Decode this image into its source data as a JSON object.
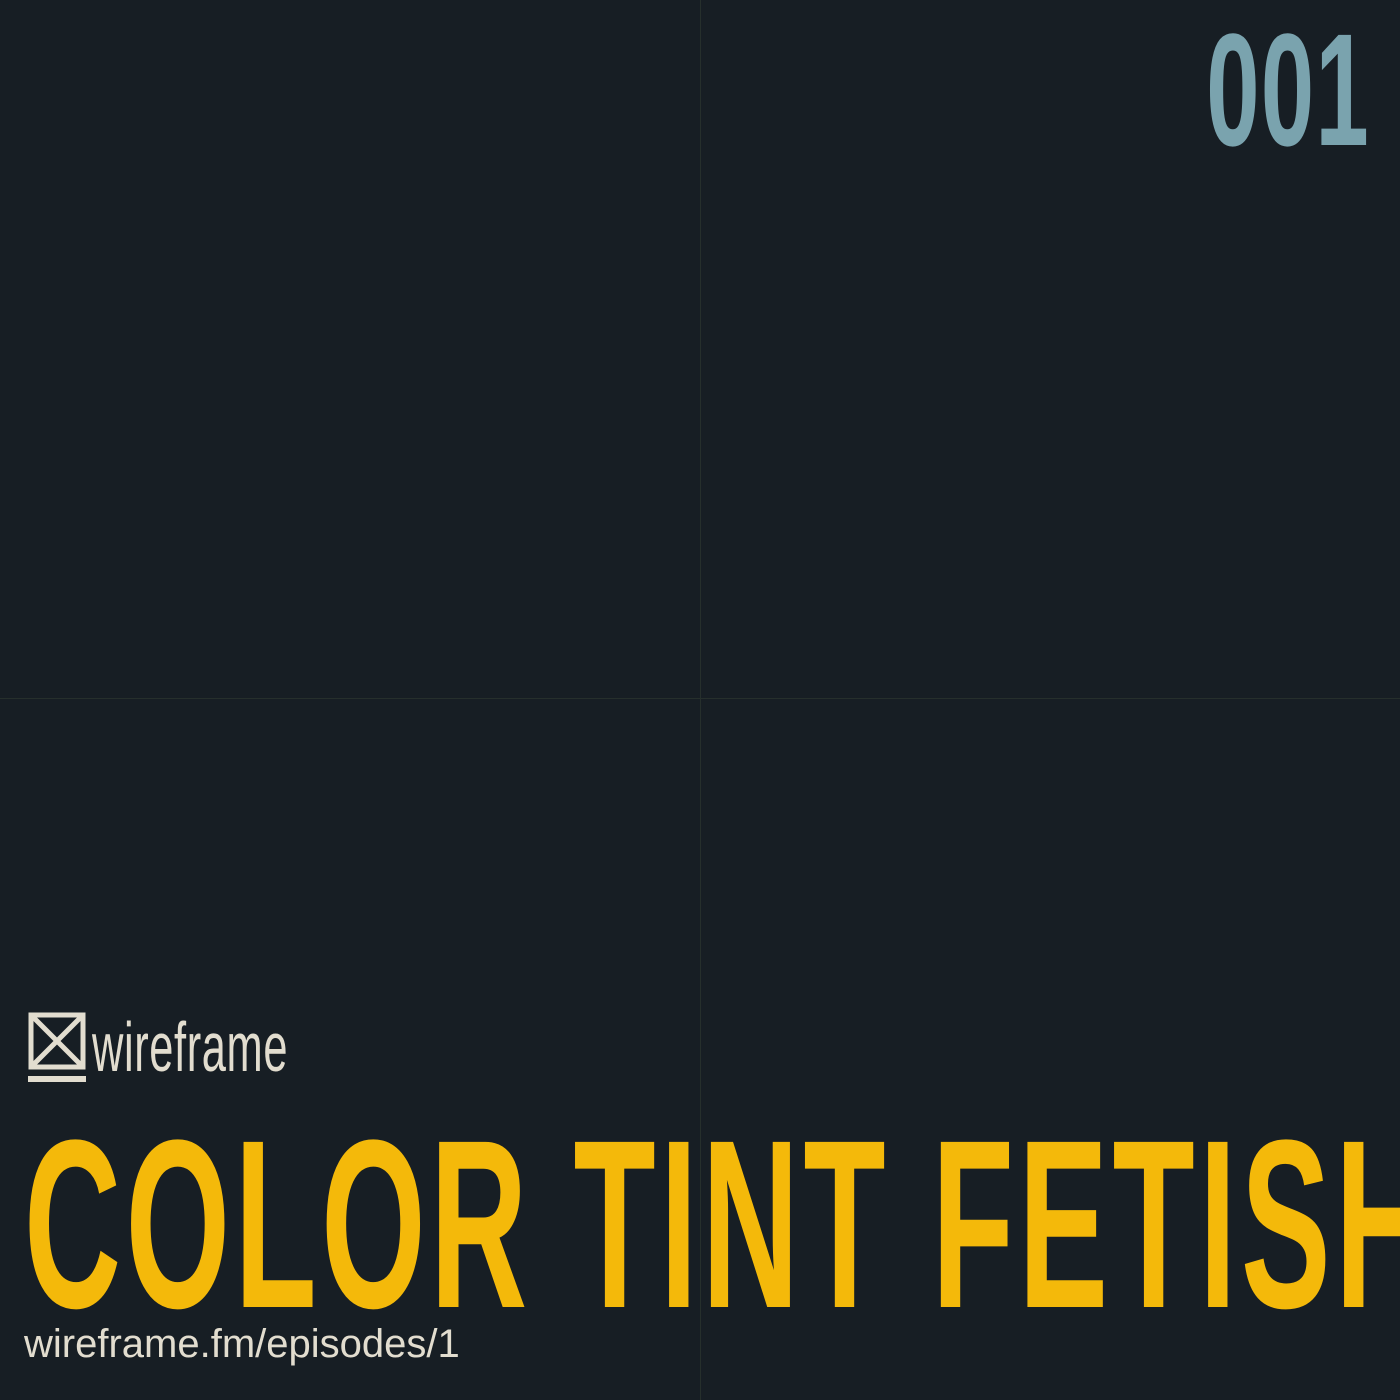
{
  "episode": {
    "number": "001",
    "color": "#7aa3ae"
  },
  "brand": {
    "name": "wireframe",
    "icon": "crossed-box-logo-icon",
    "color": "#e2ddcf"
  },
  "title": {
    "text": "COLOR TINT FETISH",
    "color": "#f4b90a"
  },
  "url": {
    "text": "wireframe.fm/episodes/1",
    "color": "#e2ddcf"
  },
  "colors": {
    "background": "#171e24",
    "grid_line": "#262f2c"
  }
}
